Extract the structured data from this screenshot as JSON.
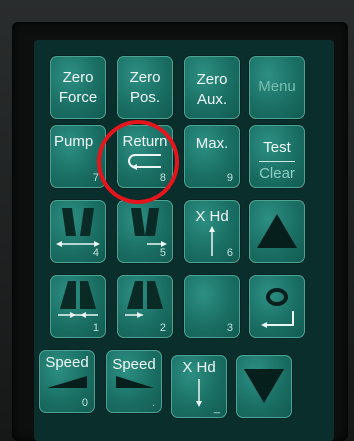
{
  "keypad": {
    "zero_force": {
      "line1": "Zero",
      "line2": "Force"
    },
    "zero_pos": {
      "line1": "Zero",
      "line2": "Pos."
    },
    "zero_aux": {
      "line1": "Zero",
      "line2": "Aux."
    },
    "menu": "Menu",
    "pump": {
      "label": "Pump",
      "number": "7"
    },
    "return": {
      "label": "Return",
      "number": "8"
    },
    "max": {
      "label": "Max.",
      "number": "9"
    },
    "test": {
      "label": "Test",
      "sub": "Clear"
    },
    "grips_open_1": {
      "number": "4"
    },
    "grips_open_2": {
      "number": "5"
    },
    "xhd_up": {
      "label": "X Hd",
      "number": "6"
    },
    "up_arrow": {},
    "grips_close_1": {
      "number": "1"
    },
    "grips_close_2": {
      "number": "2"
    },
    "blank": {
      "number": "3"
    },
    "enter": {},
    "speed_1": {
      "label": "Speed",
      "number": "0"
    },
    "speed_2": {
      "label": "Speed",
      "number": "."
    },
    "xhd_down": {
      "label": "X Hd",
      "number": "_"
    },
    "down_arrow": {}
  },
  "highlight_color": "#e4151d",
  "key_color": "#1a6e63"
}
